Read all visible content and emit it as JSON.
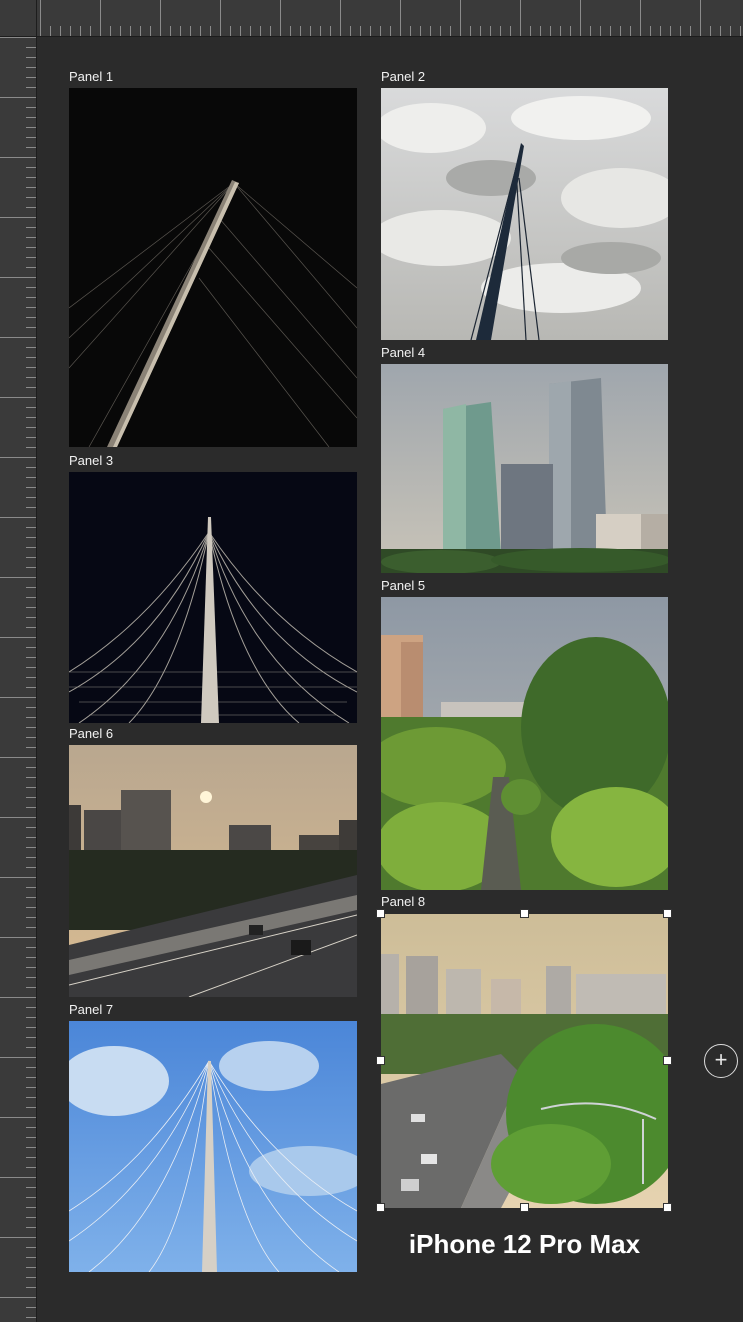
{
  "panels": [
    {
      "label": "Panel 1"
    },
    {
      "label": "Panel 2"
    },
    {
      "label": "Panel 3"
    },
    {
      "label": "Panel 4"
    },
    {
      "label": "Panel 5"
    },
    {
      "label": "Panel 6"
    },
    {
      "label": "Panel 7"
    },
    {
      "label": "Panel 8"
    }
  ],
  "device": {
    "title": "iPhone 12 Pro Max"
  },
  "controls": {
    "add_symbol": "+"
  },
  "colors": {
    "canvas": "#2b2b2b",
    "ruler": "#3a3a3a",
    "selection_handle": "#ffffff"
  }
}
